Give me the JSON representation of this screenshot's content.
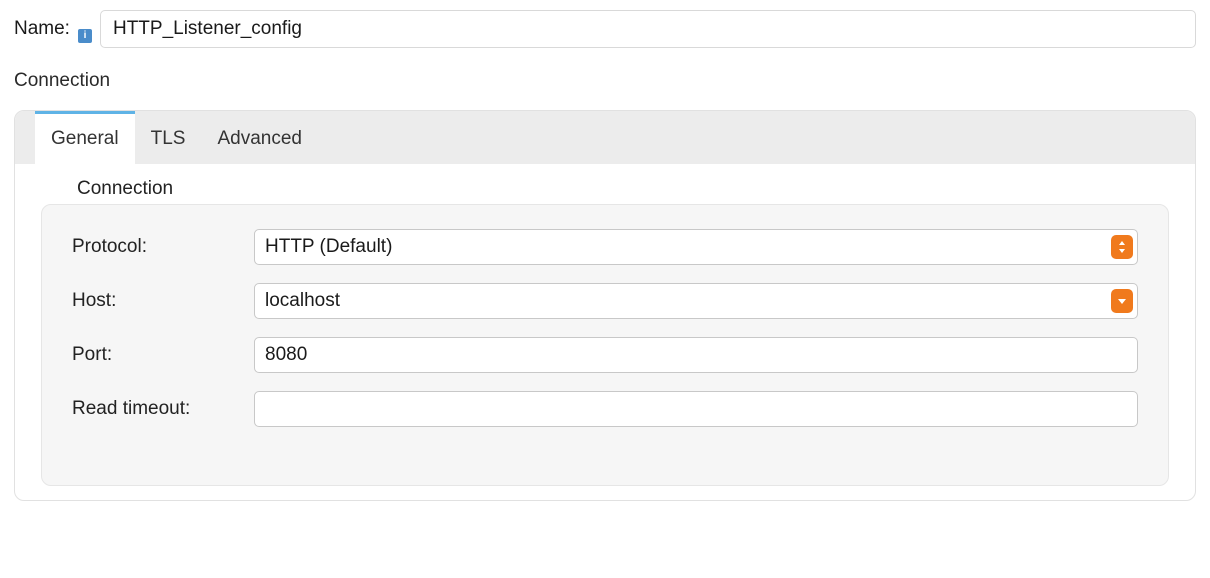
{
  "name": {
    "label": "Name:",
    "value": "HTTP_Listener_config"
  },
  "section_title": "Connection",
  "tabs": [
    {
      "label": "General"
    },
    {
      "label": "TLS"
    },
    {
      "label": "Advanced"
    }
  ],
  "fieldset_title": "Connection",
  "fields": {
    "protocol": {
      "label": "Protocol:",
      "value": "HTTP (Default)"
    },
    "host": {
      "label": "Host:",
      "value": "localhost"
    },
    "port": {
      "label": "Port:",
      "value": "8080"
    },
    "read_timeout": {
      "label": "Read timeout:",
      "value": ""
    }
  }
}
